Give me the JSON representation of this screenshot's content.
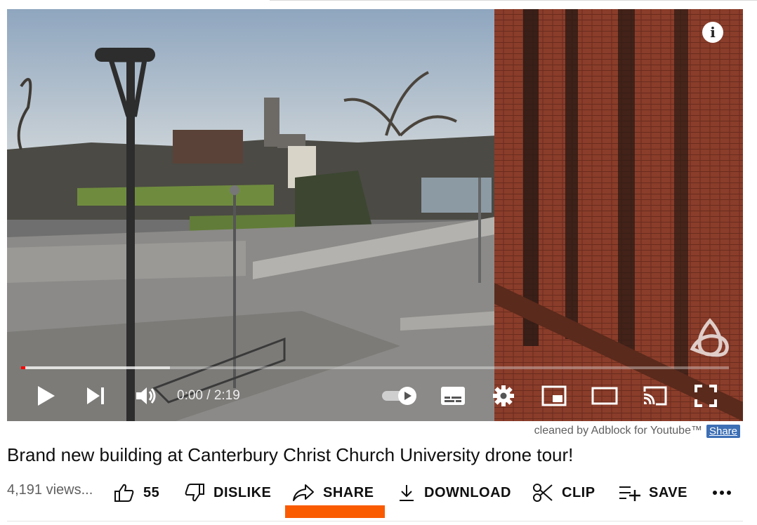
{
  "player": {
    "info_icon": "info-icon",
    "watermark_icon": "channel-watermark-icon",
    "progress": {
      "played_fraction": 0.0,
      "buffered_fraction": 0.21
    },
    "controls": {
      "play_icon": "play-icon",
      "next_icon": "next-icon",
      "volume_icon": "volume-icon",
      "time_display": "0:00 / 2:19",
      "autoplay_icon": "autoplay-toggle-icon",
      "subtitles_icon": "subtitles-icon",
      "settings_icon": "gear-icon",
      "miniplayer_icon": "miniplayer-icon",
      "theater_icon": "theater-mode-icon",
      "cast_icon": "cast-icon",
      "fullscreen_icon": "fullscreen-icon"
    }
  },
  "adblock": {
    "note": "cleaned by Adblock for Youtube™",
    "share_label": "Share"
  },
  "video": {
    "title": "Brand new building at Canterbury Christ Church University drone tour!",
    "views": "4,191 views..."
  },
  "actions": {
    "like_count": "55",
    "dislike_label": "DISLIKE",
    "share_label": "SHARE",
    "download_label": "DOWNLOAD",
    "clip_label": "CLIP",
    "save_label": "SAVE",
    "more_icon": "more-options-icon"
  },
  "colors": {
    "progress_red": "#ff0000",
    "share_highlight": "#fa5a00",
    "adblock_share_bg": "#3d6fb5"
  }
}
